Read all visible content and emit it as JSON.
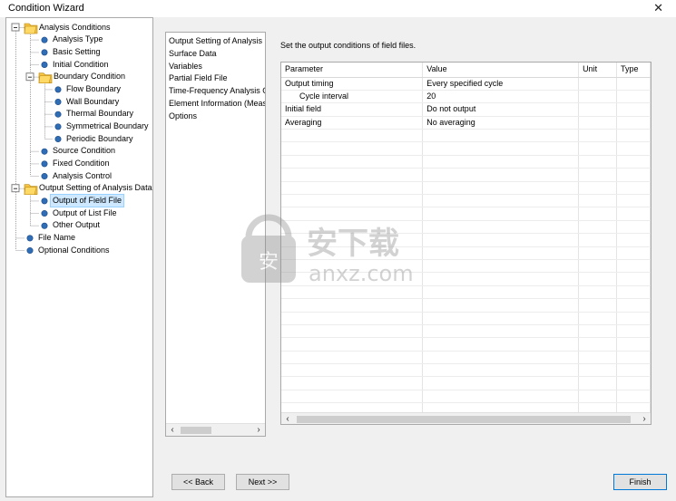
{
  "window": {
    "title": "Condition Wizard",
    "close_glyph": "✕"
  },
  "tree": {
    "nodes": [
      {
        "label": "Analysis Conditions",
        "icon": "folder-icon",
        "level": 0,
        "expander": "minus"
      },
      {
        "label": "Analysis Type",
        "icon": "bullet-icon",
        "level": 1
      },
      {
        "label": "Basic Setting",
        "icon": "bullet-icon",
        "level": 1
      },
      {
        "label": "Initial Condition",
        "icon": "bullet-icon",
        "level": 1
      },
      {
        "label": "Boundary Condition",
        "icon": "folder-icon",
        "level": 1,
        "expander": "minus"
      },
      {
        "label": "Flow Boundary",
        "icon": "bullet-icon",
        "level": 2
      },
      {
        "label": "Wall Boundary",
        "icon": "bullet-icon",
        "level": 2
      },
      {
        "label": "Thermal Boundary",
        "icon": "bullet-icon",
        "level": 2
      },
      {
        "label": "Symmetrical Boundary",
        "icon": "bullet-icon",
        "level": 2
      },
      {
        "label": "Periodic Boundary",
        "icon": "bullet-icon",
        "level": 2
      },
      {
        "label": "Source Condition",
        "icon": "bullet-icon",
        "level": 1
      },
      {
        "label": "Fixed Condition",
        "icon": "bullet-icon",
        "level": 1
      },
      {
        "label": "Analysis Control",
        "icon": "bullet-icon",
        "level": 1
      },
      {
        "label": "Output Setting of Analysis Data",
        "icon": "folder-icon",
        "level": 0,
        "expander": "minus"
      },
      {
        "label": "Output of Field File",
        "icon": "bullet-icon",
        "level": 1,
        "selected": true
      },
      {
        "label": "Output of List File",
        "icon": "bullet-icon",
        "level": 1
      },
      {
        "label": "Other Output",
        "icon": "bullet-icon",
        "level": 1
      },
      {
        "label": "File Name",
        "icon": "bullet-icon",
        "level": 0
      },
      {
        "label": "Optional Conditions",
        "icon": "bullet-icon",
        "level": 0
      }
    ]
  },
  "categories": [
    "Output Setting of Analysis D",
    "Surface Data",
    "Variables",
    "Partial Field File",
    "Time-Frequency Analysis O",
    "Element Information (Meas",
    "Options"
  ],
  "instruction": "Set the output conditions of field files.",
  "grid": {
    "columns": [
      "Parameter",
      "Value",
      "Unit",
      "Type"
    ],
    "rows": [
      {
        "parameter": "Output timing",
        "value": "Every specified cycle",
        "unit": "",
        "type": "",
        "indent": false
      },
      {
        "parameter": "Cycle interval",
        "value": "20",
        "unit": "",
        "type": "",
        "indent": true
      },
      {
        "parameter": "Initial field",
        "value": "Do not output",
        "unit": "",
        "type": "",
        "indent": false
      },
      {
        "parameter": "Averaging",
        "value": "No averaging",
        "unit": "",
        "type": "",
        "indent": false
      }
    ],
    "total_rows": 26
  },
  "scroll_arrows": {
    "left": "‹",
    "right": "›"
  },
  "buttons": {
    "back": "<< Back",
    "next": "Next >>",
    "finish": "Finish"
  },
  "watermark": {
    "text_cn": "安下载",
    "text_en": "anxz.com"
  },
  "colors": {
    "selection": "#cde8ff",
    "folder": "#f5c242",
    "bullet": "#2f6db5",
    "accent": "#0078d7"
  }
}
